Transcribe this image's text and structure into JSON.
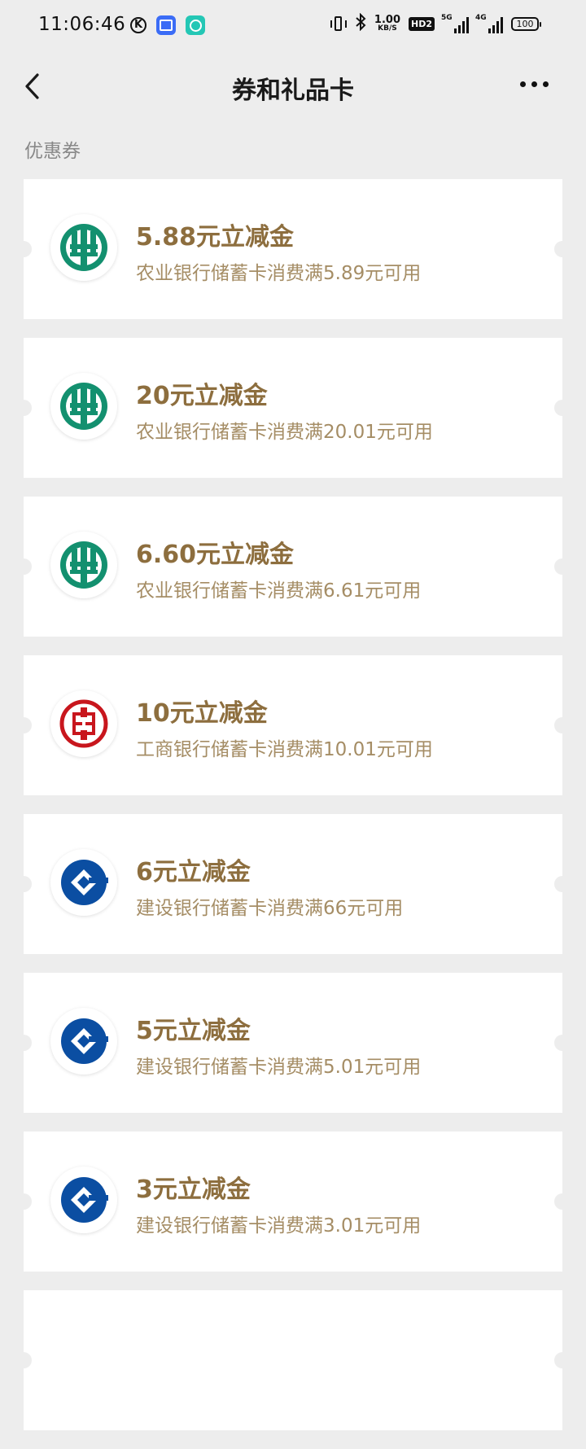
{
  "status_bar": {
    "time": "11:06:46",
    "k_label": "K",
    "net_speed_value": "1.00",
    "net_speed_unit": "KB/S",
    "hd_label": "HD2",
    "signal1_label": "5G",
    "signal2_label": "4G",
    "battery": "100"
  },
  "nav": {
    "title": "券和礼品卡"
  },
  "section": {
    "label": "优惠券"
  },
  "colors": {
    "abc_green": "#13906f",
    "icbc_red": "#c8161d",
    "ccb_blue": "#0b4ea2",
    "coupon_title": "#8d6e3e",
    "coupon_desc": "#a58d65"
  },
  "coupons": [
    {
      "logo": "abc-logo-icon",
      "title": "5.88元立减金",
      "desc": "农业银行储蓄卡消费满5.89元可用"
    },
    {
      "logo": "abc-logo-icon",
      "title": "20元立减金",
      "desc": "农业银行储蓄卡消费满20.01元可用"
    },
    {
      "logo": "abc-logo-icon",
      "title": "6.60元立减金",
      "desc": "农业银行储蓄卡消费满6.61元可用"
    },
    {
      "logo": "icbc-logo-icon",
      "title": "10元立减金",
      "desc": "工商银行储蓄卡消费满10.01元可用"
    },
    {
      "logo": "ccb-logo-icon",
      "title": "6元立减金",
      "desc": "建设银行储蓄卡消费满66元可用"
    },
    {
      "logo": "ccb-logo-icon",
      "title": "5元立减金",
      "desc": "建设银行储蓄卡消费满5.01元可用"
    },
    {
      "logo": "ccb-logo-icon",
      "title": "3元立减金",
      "desc": "建设银行储蓄卡消费满3.01元可用"
    },
    {
      "logo": "",
      "title": "",
      "desc": ""
    }
  ]
}
